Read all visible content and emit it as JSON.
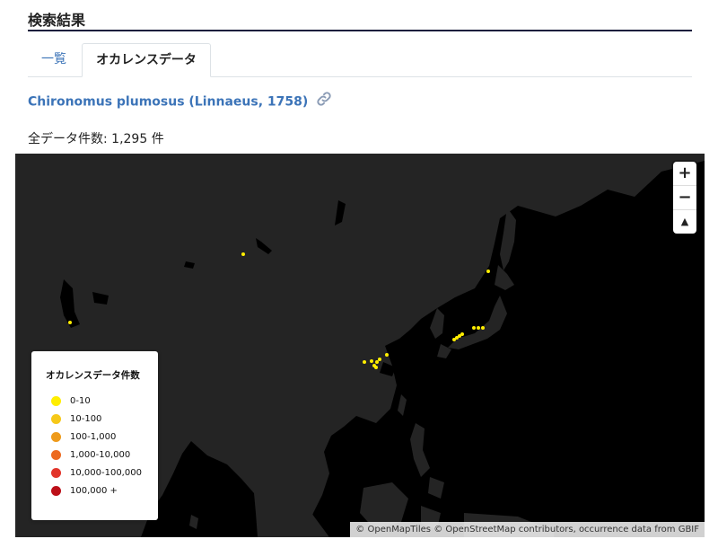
{
  "section_title": "検索結果",
  "tabs": [
    {
      "label": "一覧"
    },
    {
      "label": "オカレンスデータ"
    }
  ],
  "species_name": "Chironomus plumosus (Linnaeus, 1758)",
  "total_records": "全データ件数: 1,295 件",
  "map": {
    "zoom_in": "+",
    "zoom_out": "−",
    "reset_north": "▲",
    "legend": {
      "title": "オカレンスデータ件数",
      "items": [
        {
          "label": "0-10",
          "color": "#ffee00"
        },
        {
          "label": "10-100",
          "color": "#f6c818"
        },
        {
          "label": "100-1,000",
          "color": "#ee9a1a"
        },
        {
          "label": "1,000-10,000",
          "color": "#ec6a20"
        },
        {
          "label": "10,000-100,000",
          "color": "#e2342a"
        },
        {
          "label": "100,000 +",
          "color": "#bc0f18"
        }
      ]
    },
    "attribution": {
      "prefix": "© ",
      "openmaptiles": "OpenMapTiles",
      "sep1": " © ",
      "osm": "OpenStreetMap contributors",
      "sep2": ", ",
      "occurrence": "occurrence data from GBIF"
    },
    "colors": {
      "background": "#000000",
      "land": "#242424",
      "points": "#ffee00"
    }
  }
}
